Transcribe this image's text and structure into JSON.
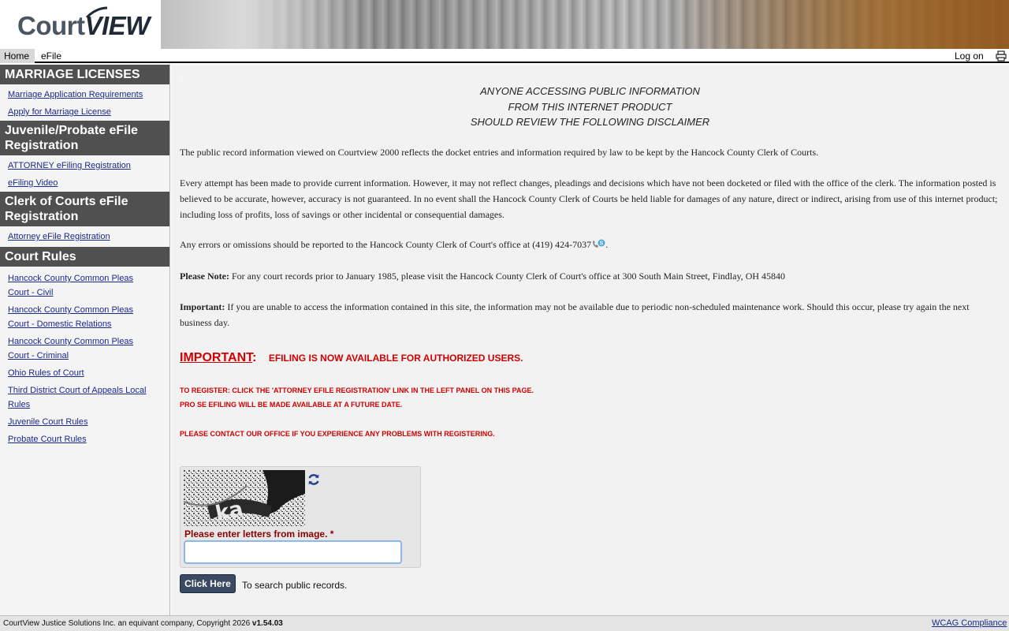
{
  "header": {
    "logo_court": "Court",
    "logo_view": "VIEW"
  },
  "nav": {
    "home": "Home",
    "efile": "eFile",
    "logon": "Log on"
  },
  "sidebar": {
    "sections": [
      {
        "title": "MARRIAGE LICENSES",
        "links": [
          "Marriage Application Requirements",
          "Apply for Marriage License"
        ]
      },
      {
        "title": "Juvenile/Probate eFile Registration",
        "links": [
          "ATTORNEY eFiling Registration",
          "eFiling Video"
        ]
      },
      {
        "title": "Clerk of Courts eFile Registration",
        "links": [
          "Attorney eFile Registration"
        ]
      },
      {
        "title": "Court Rules",
        "links": [
          "Hancock County Common Pleas Court - Civil",
          "Hancock County Common Pleas Court - Domestic Relations",
          "Hancock County Common Pleas Court - Criminal",
          "Ohio Rules of Court",
          "Third District Court of Appeals Local Rules",
          "Juvenile Court Rules",
          "Probate Court Rules"
        ]
      }
    ]
  },
  "main": {
    "disclaimer_lines": [
      "ANYONE ACCESSING PUBLIC INFORMATION",
      "FROM THIS INTERNET PRODUCT",
      "SHOULD REVIEW THE FOLLOWING DISCLAIMER"
    ],
    "para1": "The public record information viewed on Courtview 2000 reflects the docket entries and information required by law to be kept by the Hancock County Clerk of Courts.",
    "para2": "Every attempt has been made to provide current information. However, it may not reflect changes, pleadings and decisions which have not been docketed or filed with the office of the clerk. The information posted is believed to be accurate, however, accuracy is not guaranteed. In no event shall the Hancock County Clerk of Courts be held liable for damages of any nature, direct or indirect, arising from use of this internet product; including loss of profits, loss of savings or other incidental or consequential damages.",
    "para3": "Any errors or omissions should be reported to the Hancock County Clerk of Court's office at (419) 424-7037",
    "para3_end": ".",
    "note_label": "Please Note:",
    "note_text": " For any court records prior to January 1985, please visit the Hancock County Clerk of Court's office at 300 South Main Street, Findlay, OH 45840",
    "important_label": "Important:",
    "important_text": " If you are unable to access the information contained in this site, the information may not be available due to periodic non-scheduled maintenance work. Should this occur, please try again the next business day.",
    "red_important": "IMPORTANT",
    "red_colon": ":",
    "red_efiling": "EFILING IS NOW AVAILABLE FOR AUTHORIZED USERS.",
    "red_register": "TO REGISTER: CLICK THE 'ATTORNEY EFILE REGISTRATION' LINK IN THE LEFT PANEL ON THIS PAGE.",
    "red_prose": "PRO SE EFILING WILL BE MADE AVAILABLE AT A FUTURE DATE.",
    "red_contact": "PLEASE CONTACT OUR OFFICE IF YOU EXPERIENCE ANY PROBLEMS WITH REGISTERING.",
    "captcha_label": "Please enter letters from image.",
    "captcha_required": "*",
    "captcha_value": "",
    "click_button": "Click Here",
    "search_hint": "To search public records."
  },
  "footer": {
    "copyright": "CourtView Justice Solutions Inc. an equivant company, Copyright 2026 ",
    "version": "v1.54.03",
    "wcag": "WCAG Compliance"
  },
  "colors": {
    "sidebar_header": "#505050",
    "link": "#1a2a8a",
    "alert_red": "#d10000",
    "button": "#3b4a63"
  },
  "icons": [
    "print-icon",
    "refresh-icon",
    "phone-icon",
    "skype-icon"
  ]
}
